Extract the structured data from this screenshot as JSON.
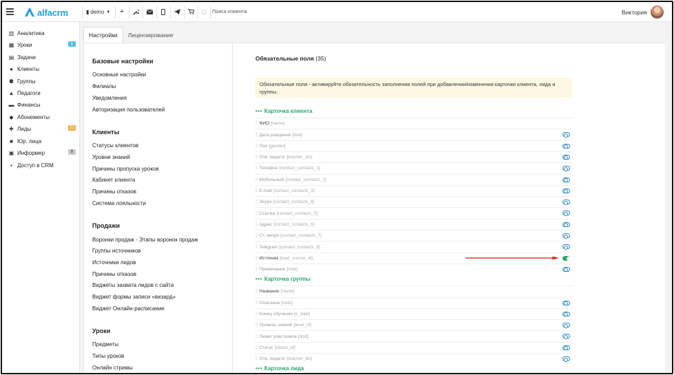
{
  "topbar": {
    "logo_text": "alfacrm",
    "branch_label": "demo",
    "search_placeholder": "Поиск клиента",
    "user_name": "Виктория"
  },
  "sidebar": {
    "items": [
      {
        "label": "Аналитика",
        "icon": "analytics-icon"
      },
      {
        "label": "Уроки",
        "icon": "calendar-icon",
        "badge": "1",
        "badge_color": "#5bc0de"
      },
      {
        "label": "Задачи",
        "icon": "tasks-icon"
      },
      {
        "label": "Клиенты",
        "icon": "user-icon"
      },
      {
        "label": "Группы",
        "icon": "group-icon"
      },
      {
        "label": "Педагоги",
        "icon": "graduation-cap-icon"
      },
      {
        "label": "Финансы",
        "icon": "money-icon"
      },
      {
        "label": "Абонементы",
        "icon": "tag-icon"
      },
      {
        "label": "Лиды",
        "icon": "user-plus-icon",
        "badge": "21",
        "badge_color": "#f0ad4e"
      },
      {
        "label": "Юр. лица",
        "icon": "briefcase-icon"
      },
      {
        "label": "Информер",
        "icon": "informer-icon",
        "badge": "8",
        "badge_color": "#c9c9c9"
      },
      {
        "label": "Доступ в CRM",
        "icon": "lock-icon"
      }
    ]
  },
  "tabs": [
    {
      "label": "Настройки",
      "active": true
    },
    {
      "label": "Лицензирование",
      "active": false
    }
  ],
  "settings_menu": {
    "groups": [
      {
        "title": "Базовые настройки",
        "links": [
          "Основные настройки",
          "Филиалы",
          "Уведомления",
          "Авторизация пользователей"
        ]
      },
      {
        "title": "Клиенты",
        "links": [
          "Статусы клиентов",
          "Уровни знаний",
          "Причины пропуска уроков",
          "Кабинет клиента",
          "Причины отказов",
          "Система лояльности"
        ]
      },
      {
        "title": "Продажи",
        "links": [
          "Воронки продаж - Этапы воронок продаж",
          "Группы источников",
          "Источники лидов",
          "Причины отказов",
          "Виджеты захвата лидов с сайта",
          "Виджет формы записи «визард»",
          "Виджет Онлайн-расписание"
        ]
      },
      {
        "title": "Уроки",
        "links": [
          "Предметы",
          "Типы уроков",
          "Онлайн стримы"
        ]
      }
    ]
  },
  "required_fields": {
    "title": "Обязательные поля",
    "count": "(35)",
    "notice": "Обязательные поля - активируйте обязательность заполнения полей при добавлении/изменении карточки клиента, лида и группы.",
    "sections": [
      {
        "title": "Карточка клиента",
        "fields": [
          {
            "label": "ФИО",
            "code": "[name]",
            "toggle": null
          },
          {
            "label": "Дата рождения",
            "code": "[dob]",
            "toggle": "off"
          },
          {
            "label": "Пол",
            "code": "[gender]",
            "toggle": "off"
          },
          {
            "label": "Отв. педагог",
            "code": "[teacher_ids]",
            "toggle": "off"
          },
          {
            "label": "Телефон",
            "code": "[contact_contacts_1]",
            "toggle": "off"
          },
          {
            "label": "Мобильный",
            "code": "[contact_contacts_2]",
            "toggle": "off"
          },
          {
            "label": "E-mail",
            "code": "[contact_contacts_3]",
            "toggle": "off"
          },
          {
            "label": "Skype",
            "code": "[contact_contacts_4]",
            "toggle": "off"
          },
          {
            "label": "Ссылка",
            "code": "[contact_contacts_5]",
            "toggle": "off"
          },
          {
            "label": "Адрес",
            "code": "[contact_contacts_6]",
            "toggle": "off"
          },
          {
            "label": "Ст. метро",
            "code": "[contact_contacts_7]",
            "toggle": "off"
          },
          {
            "label": "Telegram",
            "code": "[contact_contacts_8]",
            "toggle": "off"
          },
          {
            "label": "Источник",
            "code": "[lead_source_id]",
            "toggle": "on"
          },
          {
            "label": "Примечание",
            "code": "[note]",
            "toggle": "off"
          }
        ]
      },
      {
        "title": "Карточка группы",
        "fields": [
          {
            "label": "Название",
            "code": "[name]",
            "toggle": null
          },
          {
            "label": "Описание",
            "code": "[note]",
            "toggle": "off"
          },
          {
            "label": "Конец обучения",
            "code": "[e_date]",
            "toggle": "off"
          },
          {
            "label": "Уровень знаний",
            "code": "[level_id]",
            "toggle": "off"
          },
          {
            "label": "Лимит участников",
            "code": "[limit]",
            "toggle": "off"
          },
          {
            "label": "Статус",
            "code": "[status_id]",
            "toggle": "off"
          },
          {
            "label": "Отв. педагог",
            "code": "[teacher_ids]",
            "toggle": "off"
          }
        ]
      },
      {
        "title": "Карточка лида",
        "fields": []
      }
    ]
  },
  "colors": {
    "accent_green": "#2aa86a",
    "toggle_blue": "#2a88c8",
    "notice_bg": "#fcf8e3",
    "arrow_red": "#e53935"
  }
}
